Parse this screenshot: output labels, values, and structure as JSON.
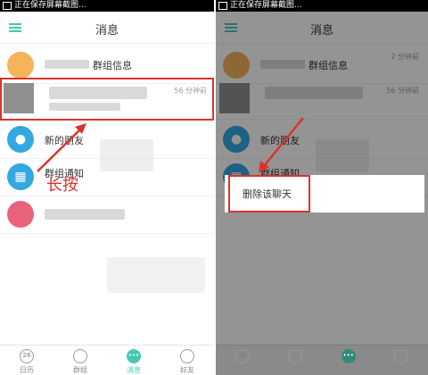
{
  "status_bar": {
    "text": "正在保存屏幕截图..."
  },
  "header": {
    "title": "消息"
  },
  "conversations": {
    "group_info": {
      "name": "群组信息"
    },
    "chat": {
      "time": "56 分钟前"
    },
    "new_friends": {
      "name": "新的朋友"
    },
    "group_notice": {
      "name": "群组通知"
    }
  },
  "right_times": {
    "first": "2 分钟前",
    "second": "56 分钟前"
  },
  "annotation": {
    "long_press": "长按"
  },
  "context_menu": {
    "delete_chat": "删除该聊天"
  },
  "tabs": [
    {
      "icon_text": "26",
      "label": "日历"
    },
    {
      "icon_text": "",
      "label": "群组"
    },
    {
      "icon_text": "•••",
      "label": "消息",
      "active": true
    },
    {
      "icon_text": "",
      "label": "好友"
    }
  ],
  "colors": {
    "accent": "#45c9b3",
    "annotation_red": "#d9342b",
    "avatar_blue": "#34a8e0"
  }
}
